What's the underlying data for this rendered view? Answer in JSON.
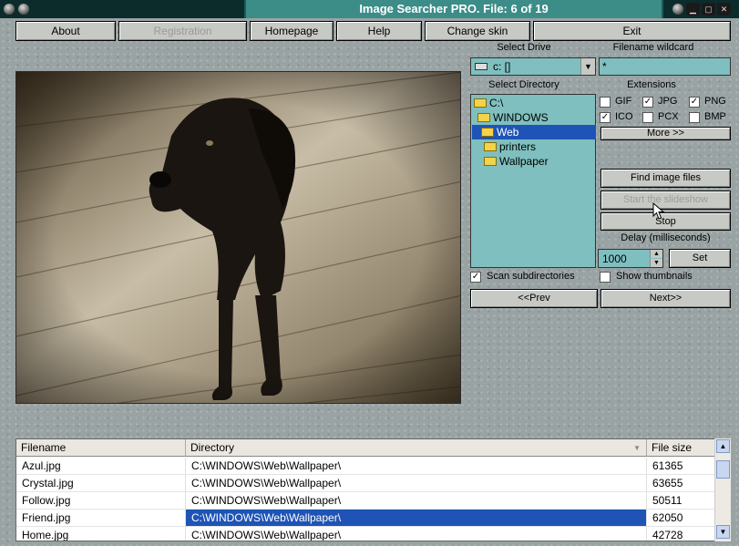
{
  "window": {
    "title": "Image Searcher PRO. File: 6 of 19"
  },
  "menu": {
    "about": "About",
    "registration": "Registration",
    "homepage": "Homepage",
    "help": "Help",
    "change_skin": "Change skin",
    "exit": "Exit"
  },
  "drive": {
    "label": "Select Drive",
    "value": "c: []"
  },
  "wildcard": {
    "label": "Filename wildcard",
    "value": "*"
  },
  "directory": {
    "label": "Select Directory",
    "nodes": [
      "C:\\",
      "WINDOWS",
      "Web",
      "printers",
      "Wallpaper"
    ],
    "selected": "Web"
  },
  "extensions": {
    "label": "Extensions",
    "items": [
      {
        "name": "GIF",
        "checked": false
      },
      {
        "name": "JPG",
        "checked": true
      },
      {
        "name": "PNG",
        "checked": true
      },
      {
        "name": "ICO",
        "checked": true
      },
      {
        "name": "PCX",
        "checked": false
      },
      {
        "name": "BMP",
        "checked": false
      }
    ],
    "more_label": "More >>"
  },
  "actions": {
    "find": "Find image files",
    "slideshow": "Start the slideshow",
    "stop": "Stop",
    "delay_label": "Delay (milliseconds)",
    "delay_value": "1000",
    "set": "Set",
    "scan_subdirs": "Scan subdirectories",
    "scan_checked": true,
    "show_thumbs": "Show thumbnails",
    "thumbs_checked": false,
    "prev": "<<Prev",
    "next": "Next>>"
  },
  "table": {
    "columns": [
      "Filename",
      "Directory",
      "File size"
    ],
    "rows": [
      {
        "filename": "Azul.jpg",
        "directory": "C:\\WINDOWS\\Web\\Wallpaper\\",
        "size": "61365"
      },
      {
        "filename": "Crystal.jpg",
        "directory": "C:\\WINDOWS\\Web\\Wallpaper\\",
        "size": "63655"
      },
      {
        "filename": "Follow.jpg",
        "directory": "C:\\WINDOWS\\Web\\Wallpaper\\",
        "size": "50511"
      },
      {
        "filename": "Friend.jpg",
        "directory": "C:\\WINDOWS\\Web\\Wallpaper\\",
        "size": "62050"
      },
      {
        "filename": "Home.jpg",
        "directory": "C:\\WINDOWS\\Web\\Wallpaper\\",
        "size": "42728"
      }
    ],
    "selected_row": 3
  },
  "colors": {
    "title_bar": "#0c2c2c",
    "title_tab": "#3c8c88",
    "tree_bg": "#7fbfbf",
    "selection": "#1f54b6"
  }
}
